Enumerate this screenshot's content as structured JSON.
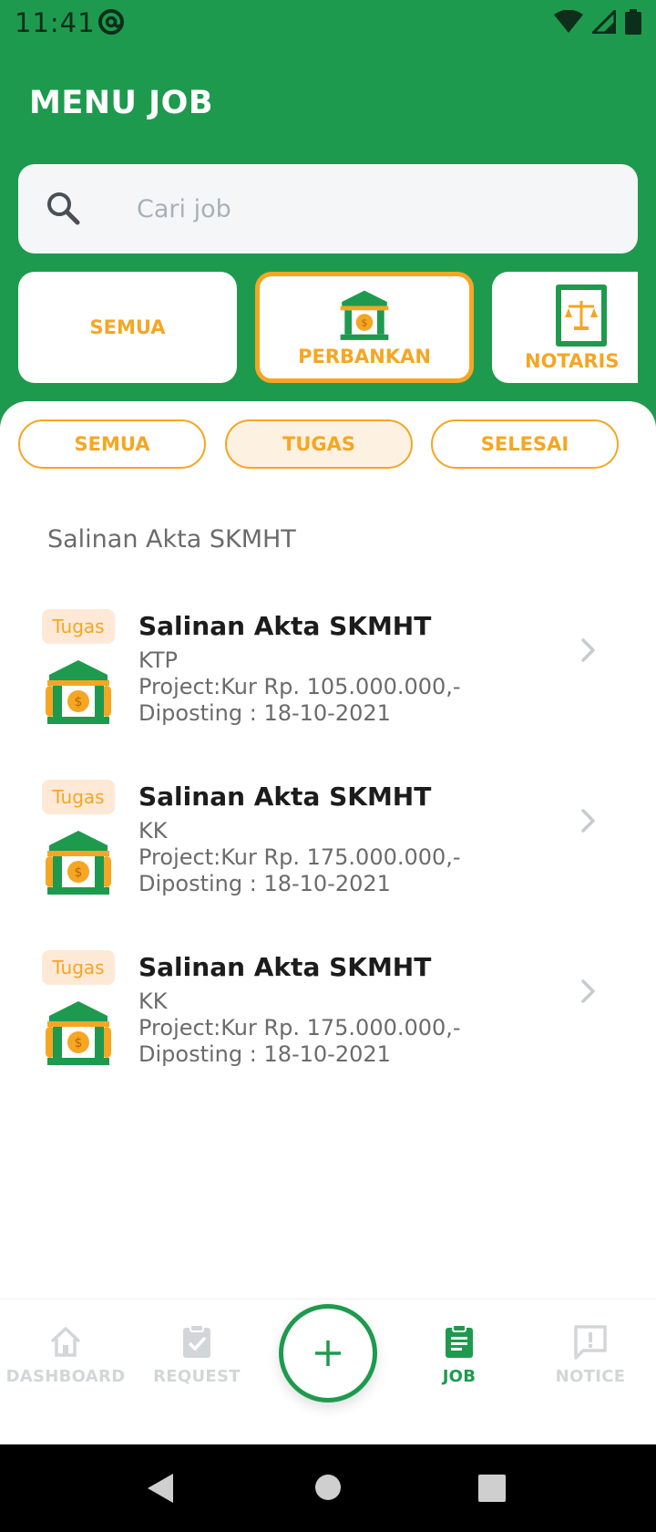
{
  "status_bar": {
    "time": "11:41",
    "icons": [
      "at-sign-icon",
      "wifi-icon",
      "signal-icon",
      "battery-icon"
    ]
  },
  "header": {
    "title": "MENU JOB"
  },
  "search": {
    "placeholder": "Cari job"
  },
  "categories": [
    {
      "label": "SEMUA",
      "icon": null,
      "active": false
    },
    {
      "label": "PERBANKAN",
      "icon": "bank-icon",
      "active": true
    },
    {
      "label": "NOTARIS",
      "icon": "notary-book-icon",
      "active": false
    }
  ],
  "filters": [
    {
      "label": "SEMUA",
      "active": false
    },
    {
      "label": "TUGAS",
      "active": true
    },
    {
      "label": "SELESAI",
      "active": false
    }
  ],
  "section_title": "Salinan Akta SKMHT",
  "jobs": [
    {
      "badge": "Tugas",
      "title": "Salinan Akta SKMHT",
      "doc": "KTP",
      "project": "Project:Kur Rp. 105.000.000,-",
      "posted": "Diposting : 18-10-2021"
    },
    {
      "badge": "Tugas",
      "title": "Salinan Akta SKMHT",
      "doc": "KK",
      "project": "Project:Kur Rp. 175.000.000,-",
      "posted": "Diposting : 18-10-2021"
    },
    {
      "badge": "Tugas",
      "title": "Salinan Akta SKMHT",
      "doc": "KK",
      "project": "Project:Kur Rp. 175.000.000,-",
      "posted": "Diposting : 18-10-2021"
    }
  ],
  "bottom_nav": [
    {
      "label": "DASHBOARD",
      "icon": "home-icon",
      "active": false
    },
    {
      "label": "REQUEST",
      "icon": "clipboard-check-icon",
      "active": false
    },
    {
      "label": "JOB",
      "icon": "clipboard-list-icon",
      "active": true
    },
    {
      "label": "NOTICE",
      "icon": "chat-alert-icon",
      "active": false
    }
  ],
  "colors": {
    "primary_green": "#1e9a4e",
    "accent_orange": "#f5a623",
    "badge_bg": "#fde9d6"
  }
}
